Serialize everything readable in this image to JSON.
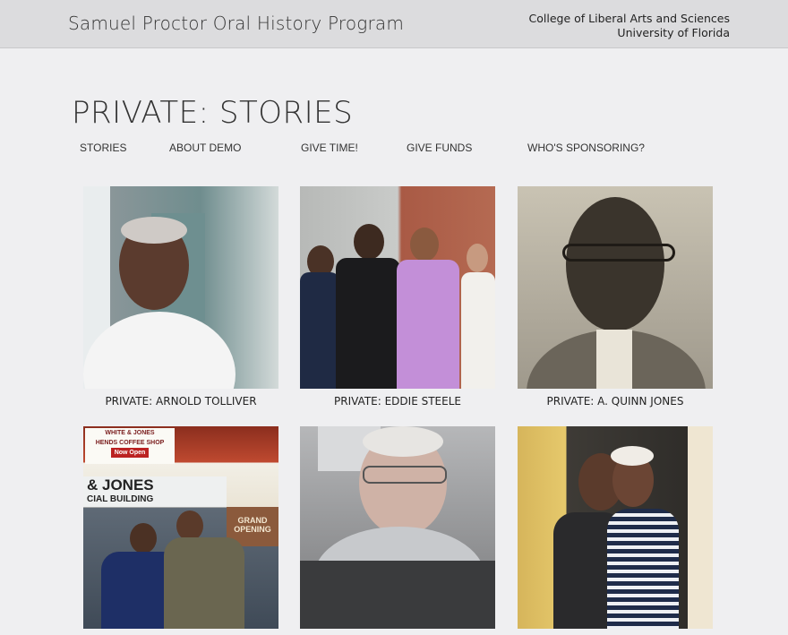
{
  "header": {
    "site_title": "Samuel Proctor Oral History Program",
    "college_line1": "College of Liberal Arts and Sciences",
    "college_line2": "University of Florida"
  },
  "page": {
    "title": "PRIVATE: STORIES"
  },
  "nav": {
    "items": [
      "STORIES",
      "ABOUT DEMO",
      "GIVE TIME!",
      "GIVE FUNDS",
      "WHO'S SPONSORING?"
    ]
  },
  "stories": [
    {
      "caption": "PRIVATE: ARNOLD TOLLIVER"
    },
    {
      "caption": "PRIVATE: EDDIE STEELE"
    },
    {
      "caption": "PRIVATE: A. QUINN JONES"
    },
    {
      "caption": ""
    },
    {
      "caption": ""
    },
    {
      "caption": ""
    }
  ],
  "photo_text": {
    "sign_top": "WHITE & JONES",
    "sign_shop": "HENDS COFFEE SHOP",
    "sign_open": "Now Open",
    "building_name": "& JONES",
    "building_sub": "CIAL BUILDING",
    "grand_opening": "GRAND OPENING"
  },
  "colors": {
    "background": "#efeff1",
    "header": "#dcdcde"
  }
}
